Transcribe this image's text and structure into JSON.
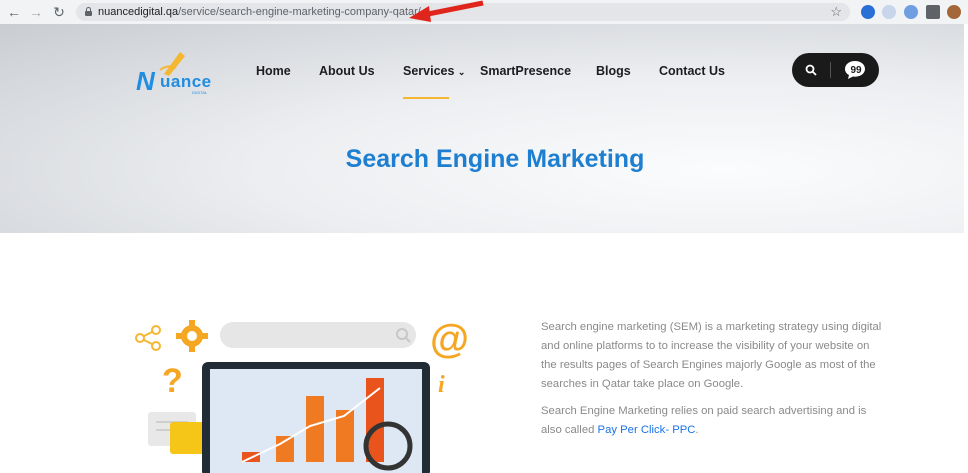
{
  "browser": {
    "url_domain": "nuancedigital.qa",
    "url_path": "/service/search-engine-marketing-company-qatar/"
  },
  "logo": {
    "first_letter": "N",
    "rest": "uance",
    "tagline": "DIGITAL"
  },
  "nav": {
    "items": [
      "Home",
      "About Us",
      "Services",
      "SmartPresence",
      "Blogs",
      "Contact Us"
    ],
    "active": "Services",
    "dropdown_item": "Services"
  },
  "hero": {
    "title": "Search Engine Marketing"
  },
  "content": {
    "para1": "Search engine marketing (SEM) is a marketing strategy using digital and online platforms to to increase the visibility of your website on the results pages of Search Engines majorly Google as most of the searches in Qatar take place on Google.",
    "para2_prefix": "Search Engine Marketing relies on paid search advertising and is also called ",
    "para2_link": "Pay Per Click- PPC",
    "para2_suffix": "."
  },
  "colors": {
    "brand_blue": "#1e7fd0",
    "accent_orange": "#f5b731",
    "link_blue": "#1a73e8",
    "annotation_red": "#e0261c"
  },
  "icons": [
    "back-icon",
    "forward-icon",
    "reload-icon",
    "lock-icon",
    "bookmark-star-icon",
    "search-icon",
    "chat-icon",
    "share-icon",
    "gear-icon",
    "question-icon",
    "at-icon",
    "info-icon",
    "magnifier-icon"
  ]
}
